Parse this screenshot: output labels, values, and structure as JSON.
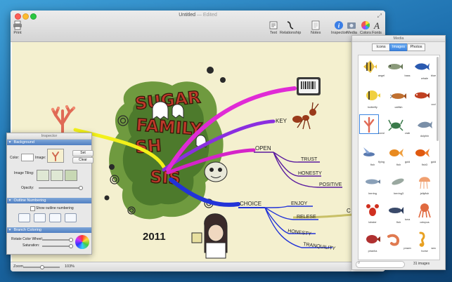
{
  "window": {
    "title": "Untitled",
    "title_suffix": "— Edited"
  },
  "toolbar": {
    "print": "Print",
    "text": "Text",
    "relationship": "Relationship",
    "notes": "Notes",
    "inspector": "Inspector",
    "media": "Media",
    "colors": "Colors",
    "fonts": "Fonts"
  },
  "statusbar": {
    "zoom_label": "Zoom",
    "zoom_value": "103%"
  },
  "mindmap": {
    "central_year": "2011",
    "branches": {
      "key": "KEY",
      "open": "OPEN",
      "choice": "CHOICE",
      "partial_right": "C"
    },
    "subtopics": {
      "trust": "TRUST",
      "honesty_open": "HONESTY",
      "positive": "POSITIVE",
      "enjoy": "ENJOY",
      "relese": "RELESE",
      "honesty_choice": "HONESTY",
      "tranquility": "TRANQUILITY"
    },
    "colors": {
      "yellow": "#f2f01a",
      "magenta": "#e02bd6",
      "purple": "#8a2ee0",
      "blue": "#2233d8",
      "tan": "#c8bf66",
      "sub_purple": "#5a1a9e"
    }
  },
  "media_panel": {
    "title": "Media",
    "tabs": [
      "Icons",
      "Images",
      "Photos"
    ],
    "active_tab": "Images",
    "items": [
      "angel",
      "bass",
      "blue whale",
      "butterfly",
      "catfish",
      "cod",
      "coral",
      "crab",
      "dolphin",
      "flying fish",
      "gold fish",
      "gold fish3",
      "herring",
      "herring3",
      "jellyfish",
      "lobster",
      "tuna fish",
      "octopus",
      "piranha",
      "prawn",
      "sea horse"
    ],
    "selected": "coral",
    "count": "31 images",
    "search_placeholder": ""
  },
  "inspector": {
    "title": "Inspector",
    "sections": {
      "background": "Background",
      "outline": "Outline Numbering",
      "branch": "Branch Coloring"
    },
    "color_label": "Color:",
    "image_label": "Image:",
    "set_button": "Set",
    "clear_button": "Clear",
    "tiling_label": "Image Tiling:",
    "opacity_label": "Opacity:",
    "opacity_value": 0.95,
    "show_outline": "Show outline numbering",
    "rotate_label": "Rotate Color Wheel:",
    "saturation_label": "Saturation:",
    "rotate_value": 0.92,
    "saturation_value": 0.92
  }
}
